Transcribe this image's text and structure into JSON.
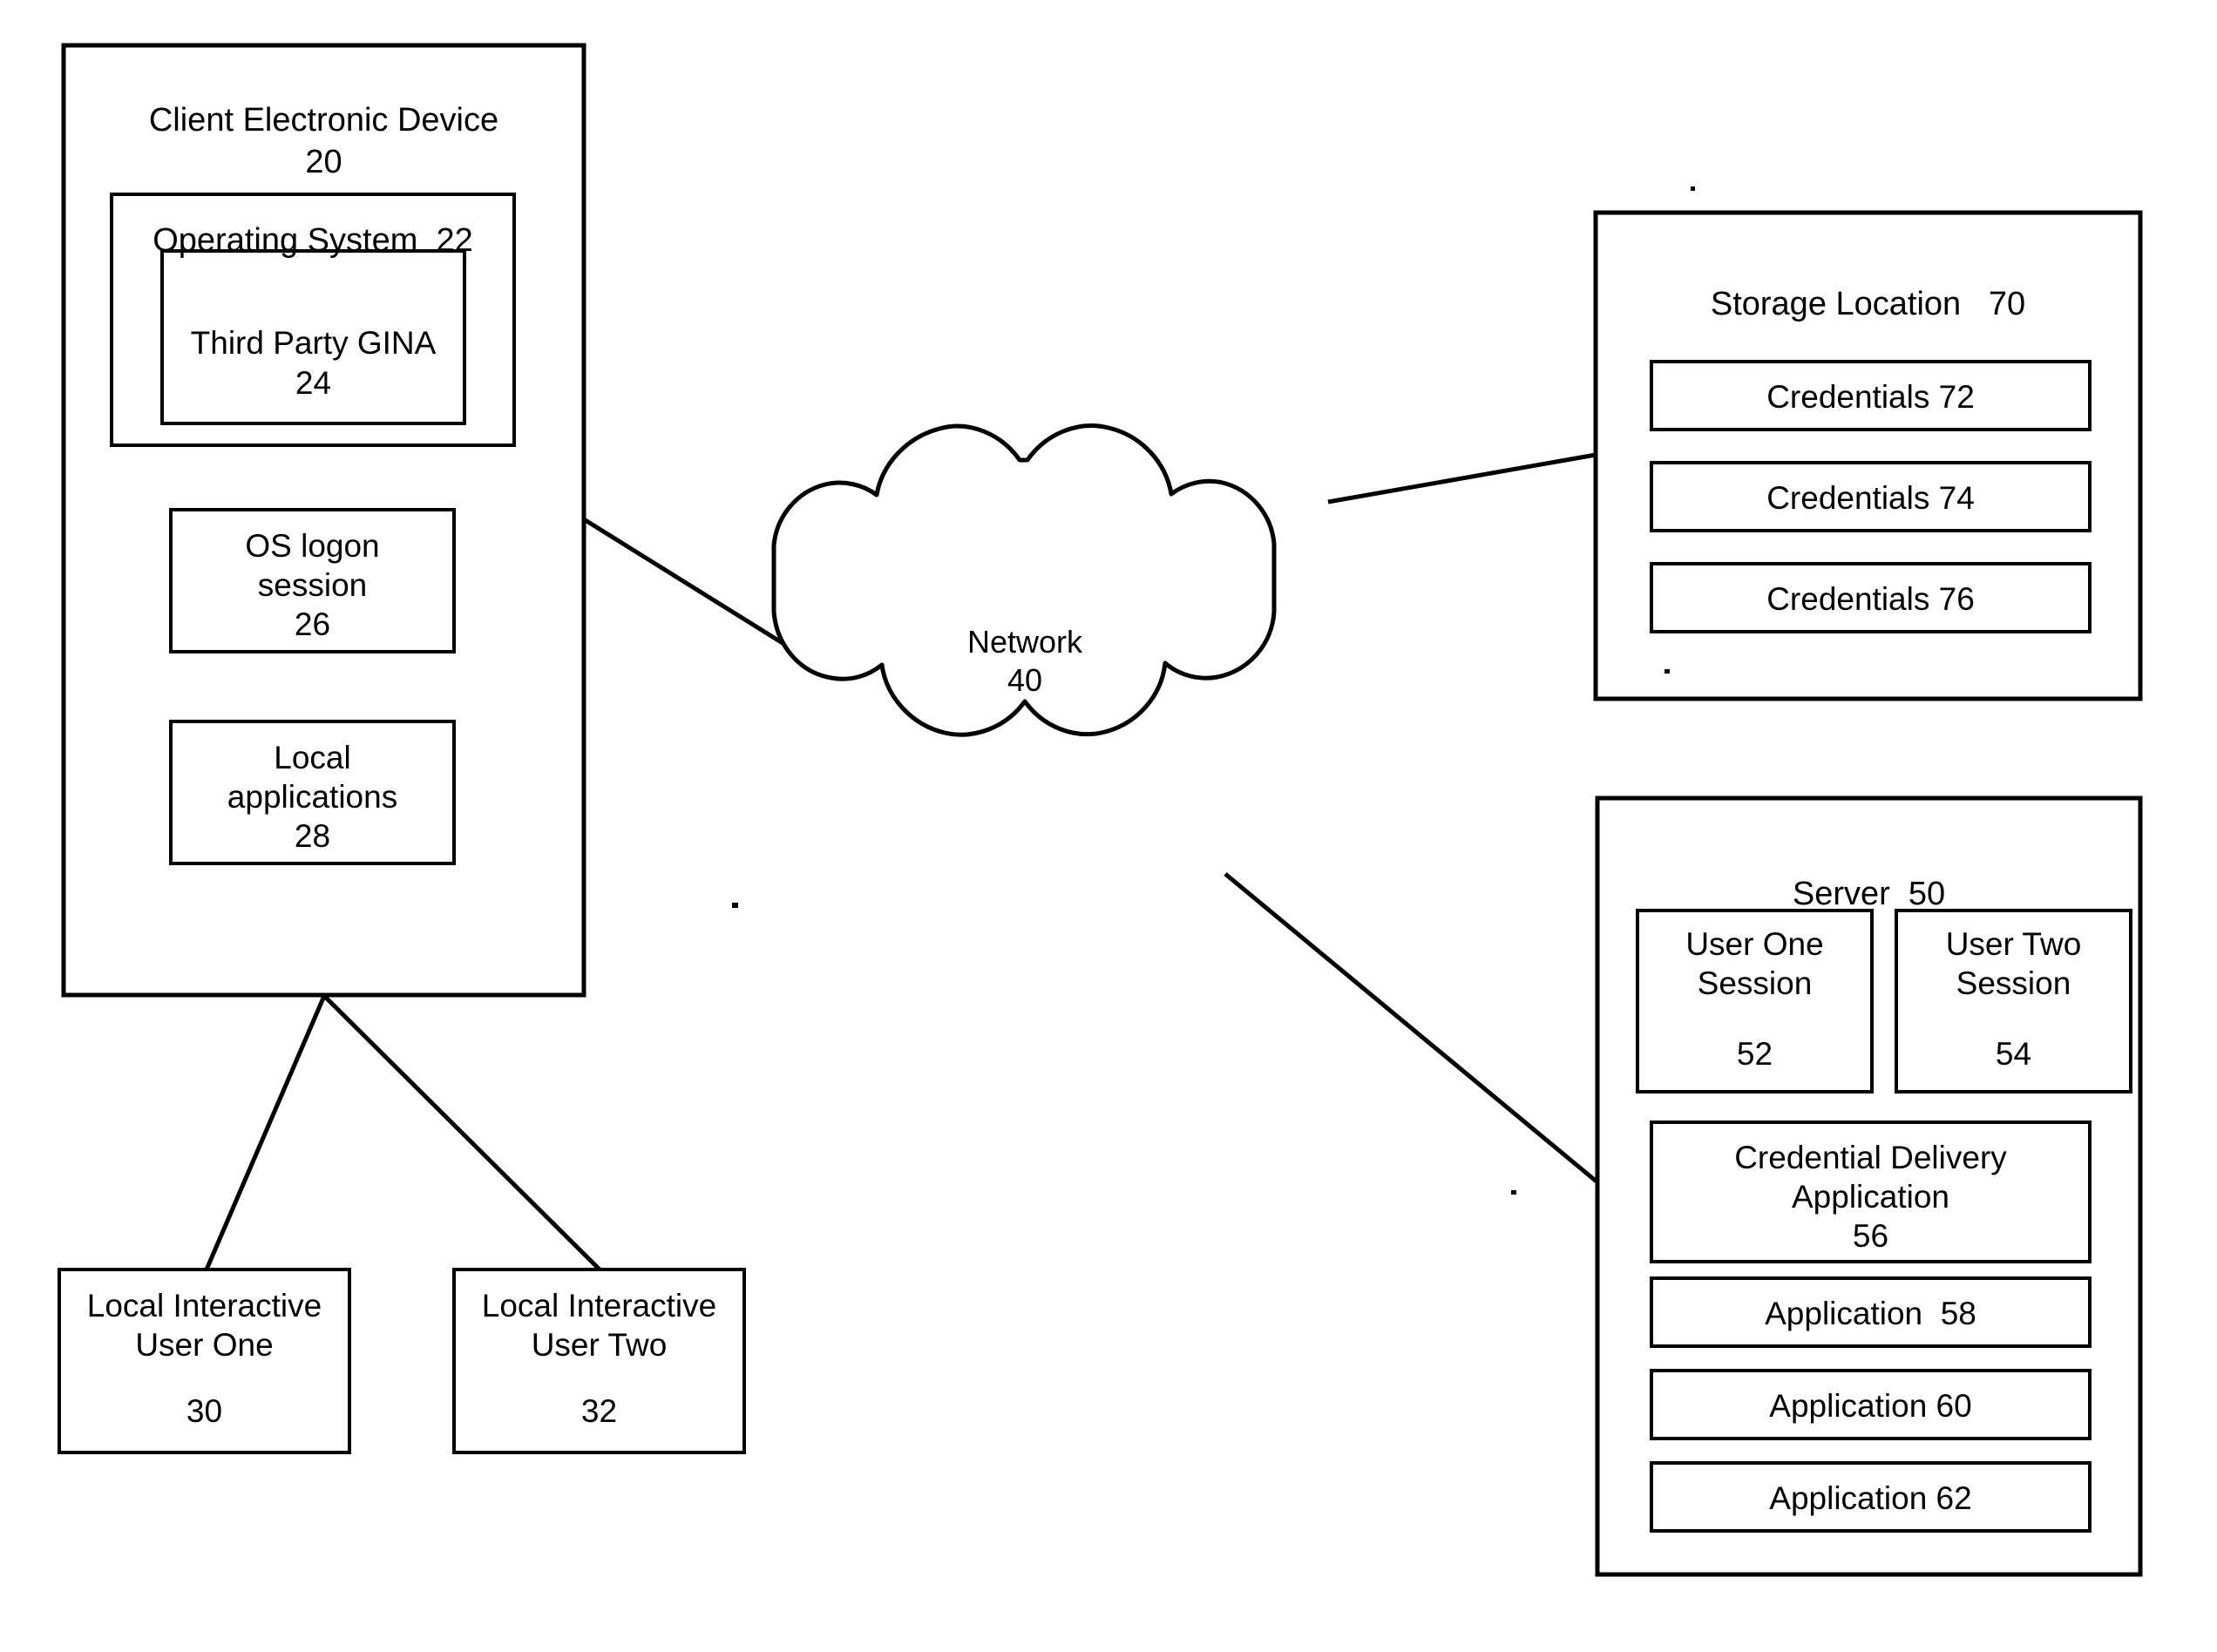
{
  "figure": {
    "type": "patent-block-diagram",
    "background_color": "#ffffff",
    "line_color": "#000000"
  },
  "client": {
    "title": "Client Electronic Device",
    "ref": "20",
    "os": {
      "title": "Operating System  22",
      "gina": {
        "title": "Third Party GINA",
        "ref": "24"
      }
    },
    "logon_session": {
      "line1": "OS logon",
      "line2": "session",
      "ref": "26"
    },
    "local_applications": {
      "line1": "Local",
      "line2": "applications",
      "ref": "28"
    }
  },
  "local_users": [
    {
      "line1": "Local Interactive",
      "line2": "User One",
      "ref": "30"
    },
    {
      "line1": "Local Interactive",
      "line2": "User Two",
      "ref": "32"
    }
  ],
  "network": {
    "title": "Network",
    "ref": "40"
  },
  "storage": {
    "title": "Storage Location   70",
    "credentials": [
      "Credentials 72",
      "Credentials 74",
      "Credentials 76"
    ]
  },
  "server": {
    "title": "Server  50",
    "sessions": [
      {
        "line1": "User One",
        "line2": "Session",
        "ref": "52"
      },
      {
        "line1": "User Two",
        "line2": "Session",
        "ref": "54"
      }
    ],
    "credential_delivery": {
      "line1": "Credential Delivery",
      "line2": "Application",
      "ref": "56"
    },
    "applications": [
      "Application  58",
      "Application 60",
      "Application 62"
    ]
  }
}
